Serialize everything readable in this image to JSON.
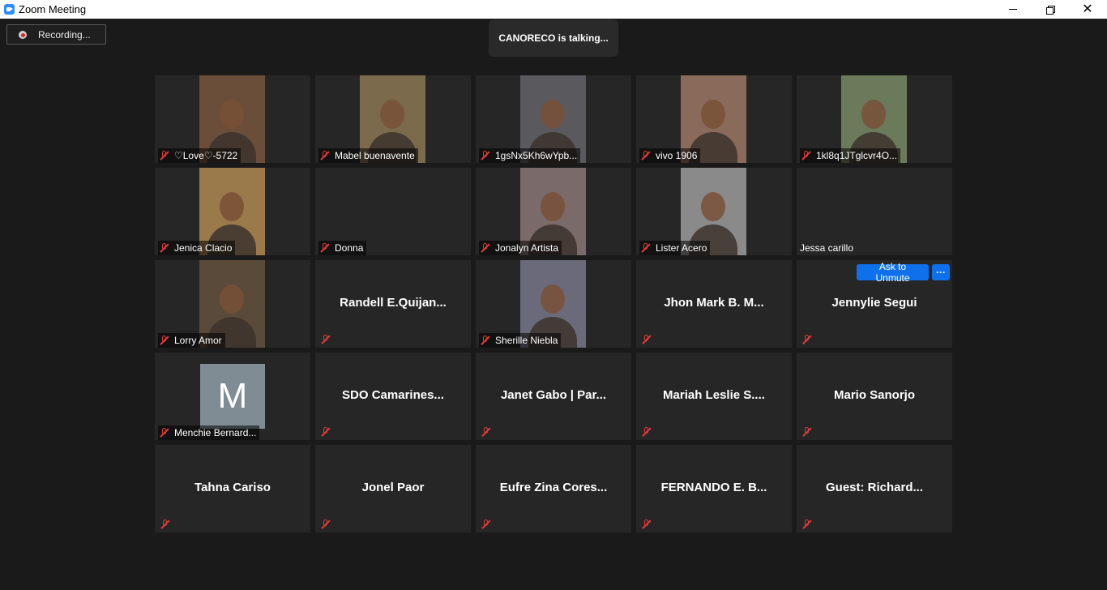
{
  "window": {
    "title": "Zoom Meeting",
    "minimize": "—",
    "close": "✕"
  },
  "recording": {
    "label": "Recording..."
  },
  "banner": {
    "talking": "CANORECO is talking..."
  },
  "colors": {
    "accent": "#0e71eb",
    "muted_icon": "#e33a3a",
    "tile_bg": "#262626",
    "page_bg": "#1a1a1a"
  },
  "tiles": [
    {
      "name": "♡Love♡-5722",
      "video": true,
      "bg": "#6b4e3a"
    },
    {
      "name": "Mabel buenavente",
      "video": true,
      "bg": "#7b6a4c"
    },
    {
      "name": "1gsNx5Kh6wYpb...",
      "video": true,
      "bg": "#5a5a5e"
    },
    {
      "name": "vivo 1906",
      "video": true,
      "bg": "#8a6a5a"
    },
    {
      "name": "1kl8q1JTglcvr4O...",
      "video": true,
      "bg": "#6a7a5a"
    },
    {
      "name": "Jenica Clacio",
      "video": true,
      "bg": "#9a7a4a"
    },
    {
      "name": "Donna",
      "video": false
    },
    {
      "name": "Jonalyn Artista",
      "video": true,
      "bg": "#7a6a6a"
    },
    {
      "name": "Lister Acero",
      "video": true,
      "bg": "#8a8a8a"
    },
    {
      "name": "Jessa carillo",
      "video": false,
      "nomute": true
    },
    {
      "name": "Lorry Amor",
      "video": true,
      "bg": "#5a4a3a"
    },
    {
      "center": "Randell  E.Quijan..."
    },
    {
      "name": "Sherille Niebla",
      "video": true,
      "bg": "#6a6a7a"
    },
    {
      "center": "Jhon Mark B. M..."
    },
    {
      "center": "Jennylie Segui",
      "unmute": "Ask to Unmute",
      "more": "···"
    },
    {
      "name": "Menchie Bernard...",
      "avatar": "M"
    },
    {
      "center": "SDO  Camarines..."
    },
    {
      "center": "Janet Gabo | Par..."
    },
    {
      "center": "Mariah  Leslie  S...."
    },
    {
      "center": "Mario Sanorjo"
    },
    {
      "center": "Tahna Cariso"
    },
    {
      "center": "Jonel Paor"
    },
    {
      "center": "Eufre Zina Cores..."
    },
    {
      "center": "FERNANDO E. B..."
    },
    {
      "center": "Guest:  Richard..."
    }
  ]
}
